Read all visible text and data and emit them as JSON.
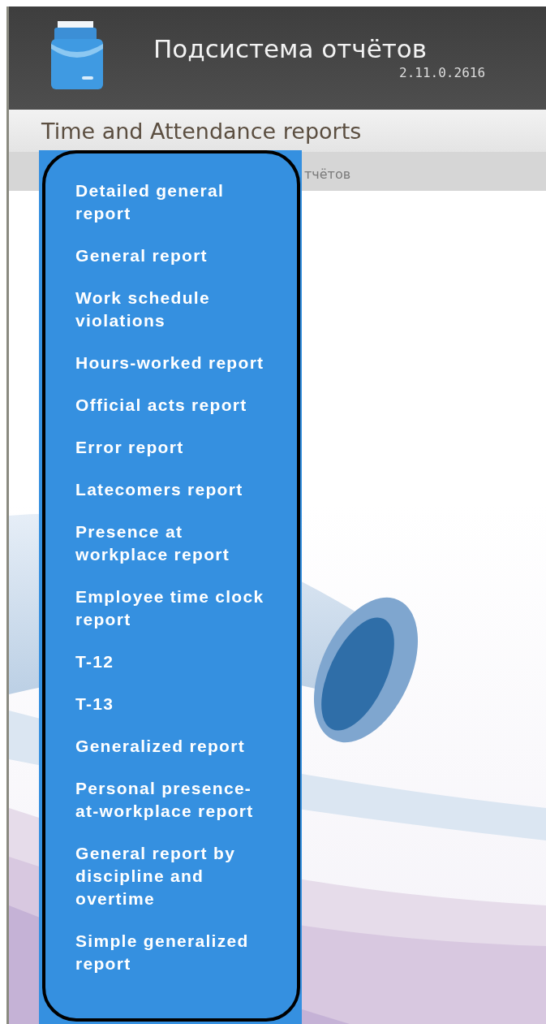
{
  "header": {
    "title": "Подсистема отчётов",
    "version": "2.11.0.2616"
  },
  "section_title": "Time and Attendance reports",
  "breadcrumb": "тчётов",
  "menu": {
    "items": [
      {
        "label": "Detailed general report"
      },
      {
        "label": "General report"
      },
      {
        "label": "Work schedule violations"
      },
      {
        "label": "Hours-worked report"
      },
      {
        "label": "Official acts report"
      },
      {
        "label": "Error report"
      },
      {
        "label": "Latecomers report"
      },
      {
        "label": "Presence at workplace report"
      },
      {
        "label": "Employee time clock report"
      },
      {
        "label": "T-12"
      },
      {
        "label": "T-13"
      },
      {
        "label": "Generalized report"
      },
      {
        "label": "Personal presence-at-workplace report"
      },
      {
        "label": "General report by discipline and overtime"
      },
      {
        "label": "Simple generalized report"
      }
    ]
  }
}
